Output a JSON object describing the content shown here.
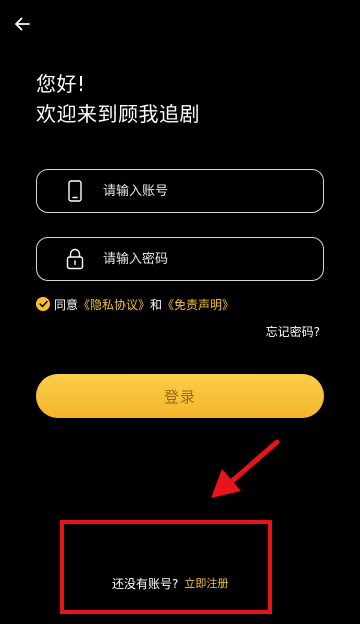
{
  "header": {
    "back_icon": "arrow-left-icon"
  },
  "welcome": {
    "greeting": "您好!",
    "message": "欢迎来到顾我追剧"
  },
  "form": {
    "account": {
      "icon": "phone-icon",
      "placeholder": "请输入账号",
      "value": ""
    },
    "password": {
      "icon": "lock-icon",
      "placeholder": "请输入密码",
      "value": ""
    }
  },
  "agreement": {
    "checked": true,
    "prefix": "同意",
    "privacy_link": "《隐私协议》",
    "conjunction": "和",
    "disclaimer_link": "《免责声明》"
  },
  "forgot_password": "忘记密码?",
  "login_button": "登录",
  "register": {
    "question": "还没有账号?",
    "link": "立即注册"
  },
  "colors": {
    "background": "#000000",
    "accent": "#f6c12f",
    "button_text": "#9a6a12",
    "annotation_red": "#e7141c"
  }
}
